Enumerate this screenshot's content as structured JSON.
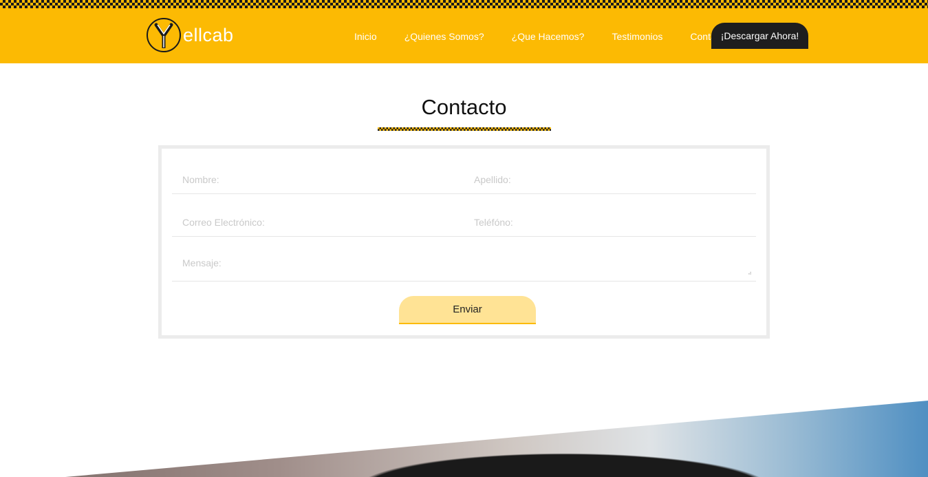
{
  "brand": {
    "logo_letter": "Y",
    "logo_text": "ellcab"
  },
  "nav": {
    "items": [
      {
        "label": "Inicio"
      },
      {
        "label": "¿Quienes Somos?"
      },
      {
        "label": "¿Que Hacemos?"
      },
      {
        "label": "Testimonios"
      },
      {
        "label": "Contacto"
      }
    ],
    "cta_label": "¡Descargar Ahora!"
  },
  "contact": {
    "title": "Contacto",
    "fields": {
      "nombre": "Nombre:",
      "apellido": "Apellido:",
      "correo": "Correo Electrónico:",
      "telefono": "Teléfóno:",
      "mensaje": "Mensaje:"
    },
    "send_label": "Enviar"
  },
  "colors": {
    "brand_yellow": "#fcba03",
    "dark": "#1e1e1e",
    "button_light": "#ffe395"
  }
}
